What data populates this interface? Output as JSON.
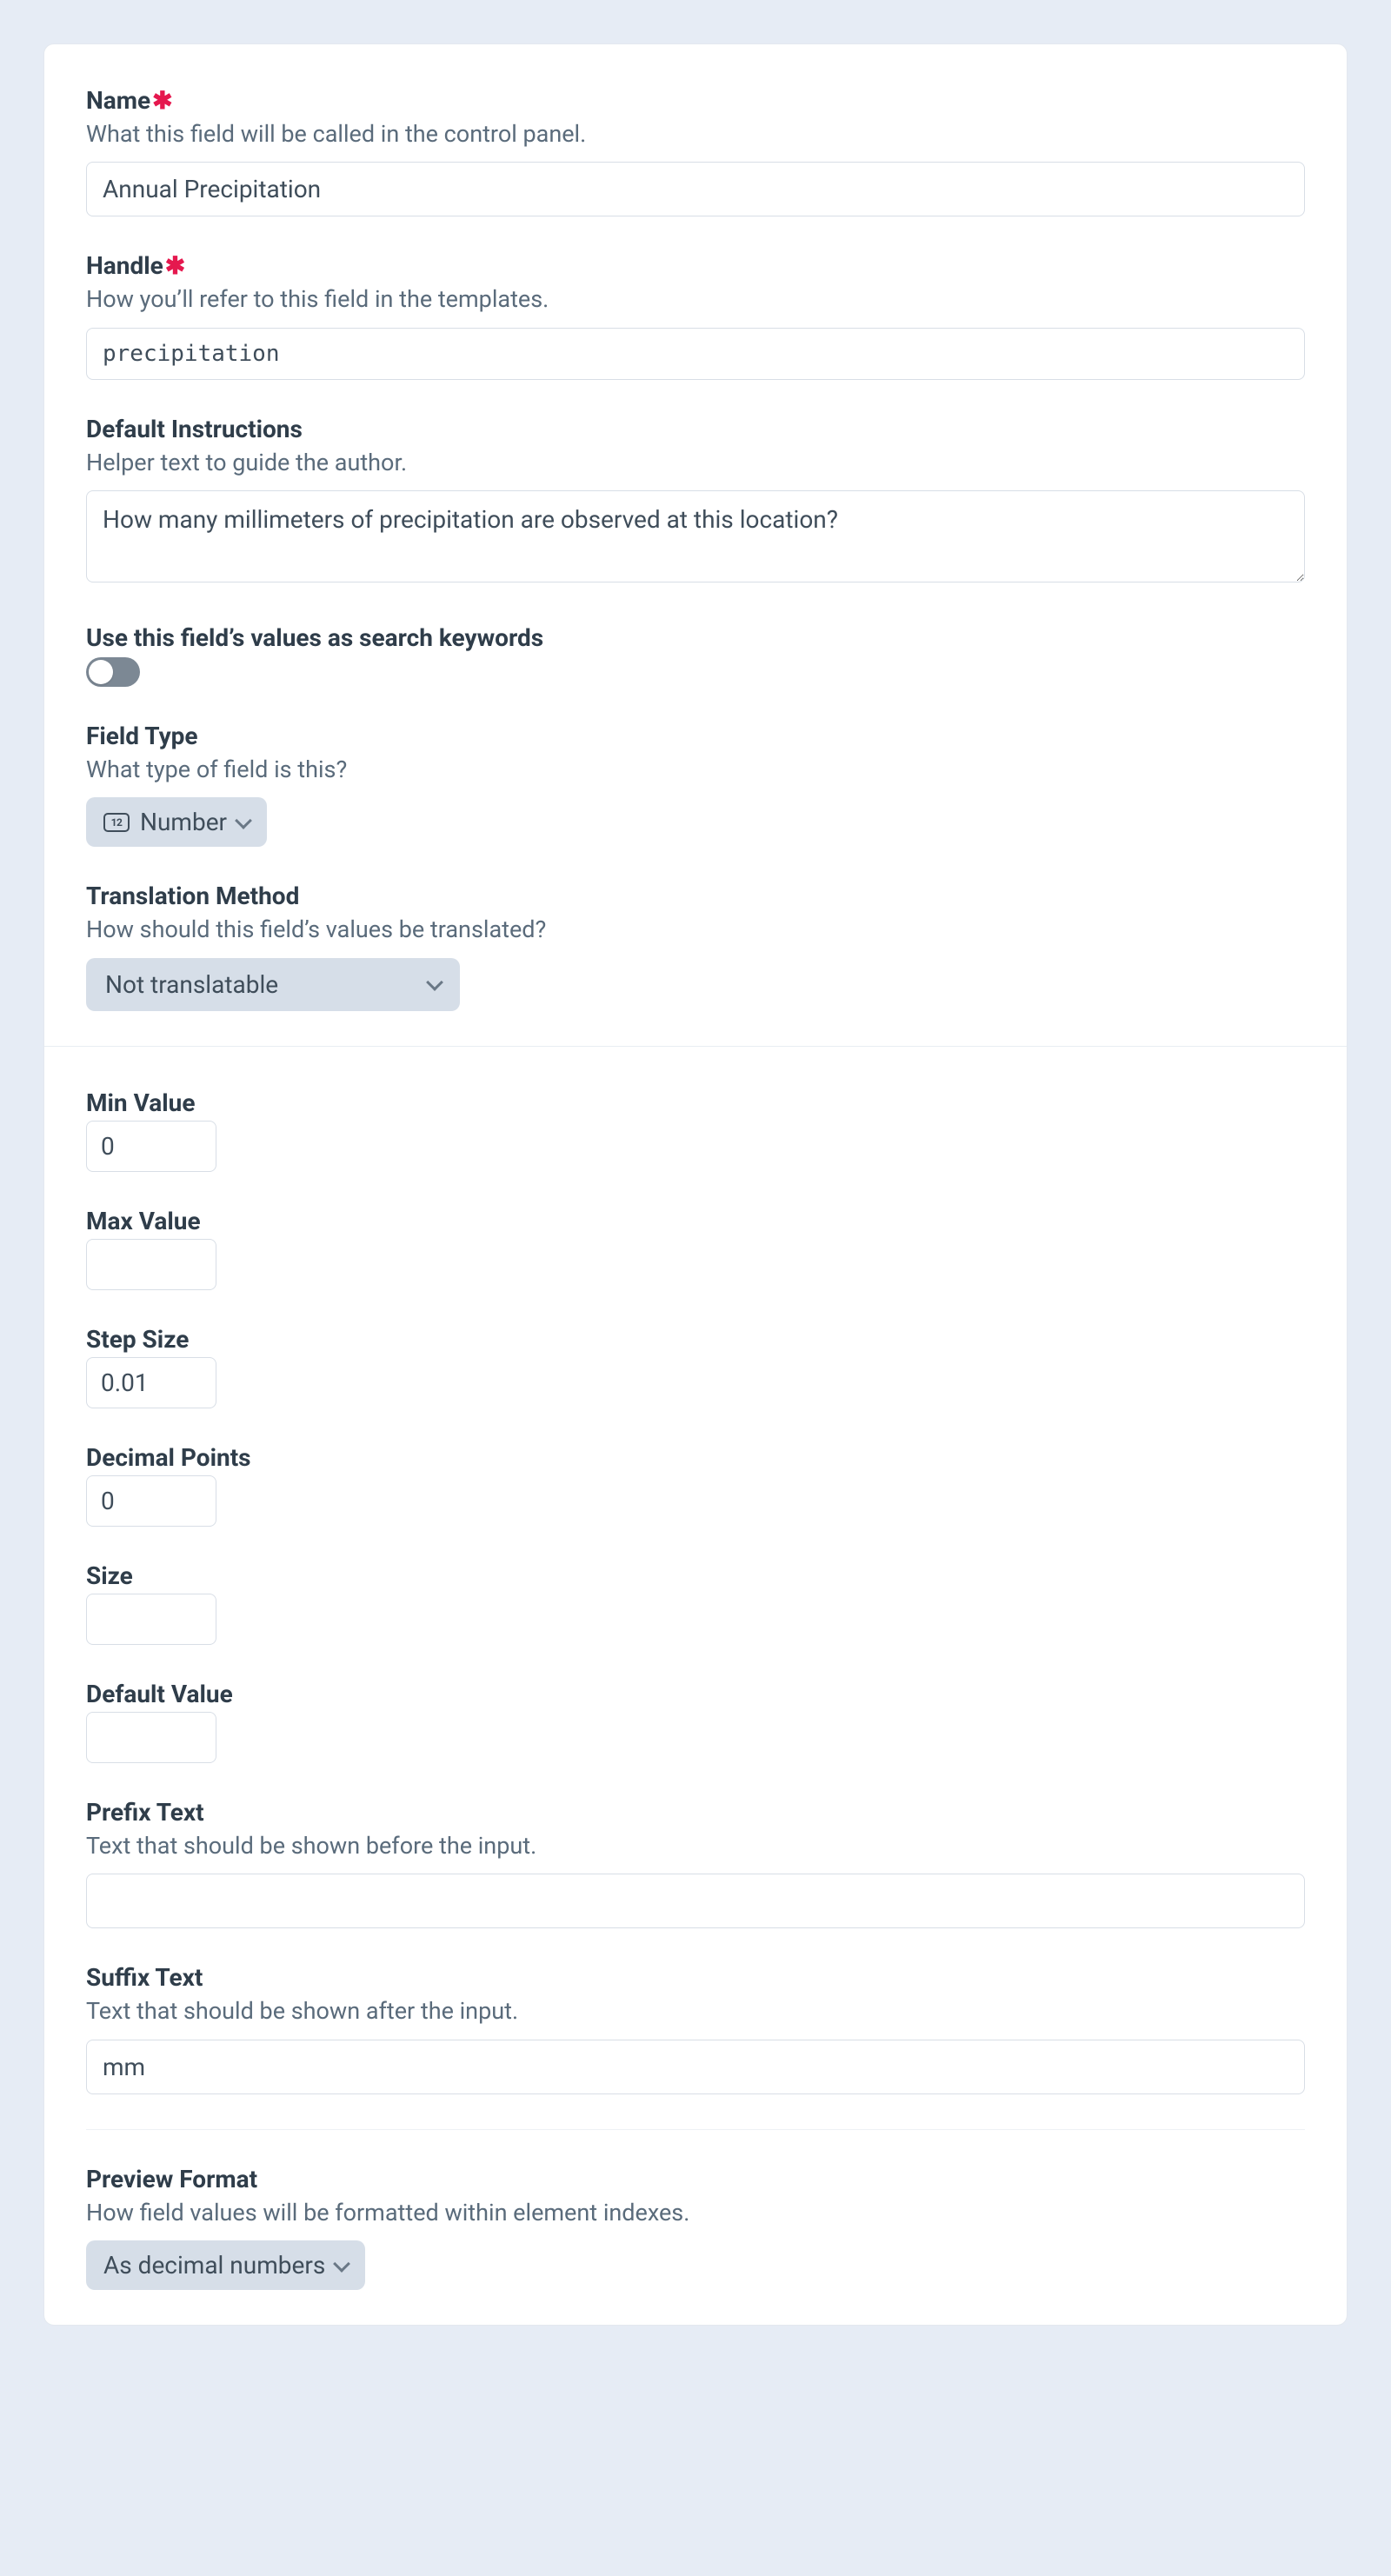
{
  "name": {
    "label": "Name",
    "help": "What this field will be called in the control panel.",
    "value": "Annual Precipitation"
  },
  "handle": {
    "label": "Handle",
    "help": "How you’ll refer to this field in the templates.",
    "value": "precipitation"
  },
  "instructions": {
    "label": "Default Instructions",
    "help": "Helper text to guide the author.",
    "value": "How many millimeters of precipitation are observed at this location?"
  },
  "search": {
    "label": "Use this field’s values as search keywords",
    "value": false
  },
  "fieldType": {
    "label": "Field Type",
    "help": "What type of field is this?",
    "selected": "Number"
  },
  "translation": {
    "label": "Translation Method",
    "help": "How should this field’s values be translated?",
    "selected": "Not translatable"
  },
  "minValue": {
    "label": "Min Value",
    "value": "0"
  },
  "maxValue": {
    "label": "Max Value",
    "value": ""
  },
  "stepSize": {
    "label": "Step Size",
    "value": "0.01"
  },
  "decimalPoints": {
    "label": "Decimal Points",
    "value": "0"
  },
  "size": {
    "label": "Size",
    "value": ""
  },
  "defaultValue": {
    "label": "Default Value",
    "value": ""
  },
  "prefix": {
    "label": "Prefix Text",
    "help": "Text that should be shown before the input.",
    "value": ""
  },
  "suffix": {
    "label": "Suffix Text",
    "help": "Text that should be shown after the input.",
    "value": "mm"
  },
  "previewFormat": {
    "label": "Preview Format",
    "help": "How field values will be formatted within element indexes.",
    "selected": "As decimal numbers"
  }
}
